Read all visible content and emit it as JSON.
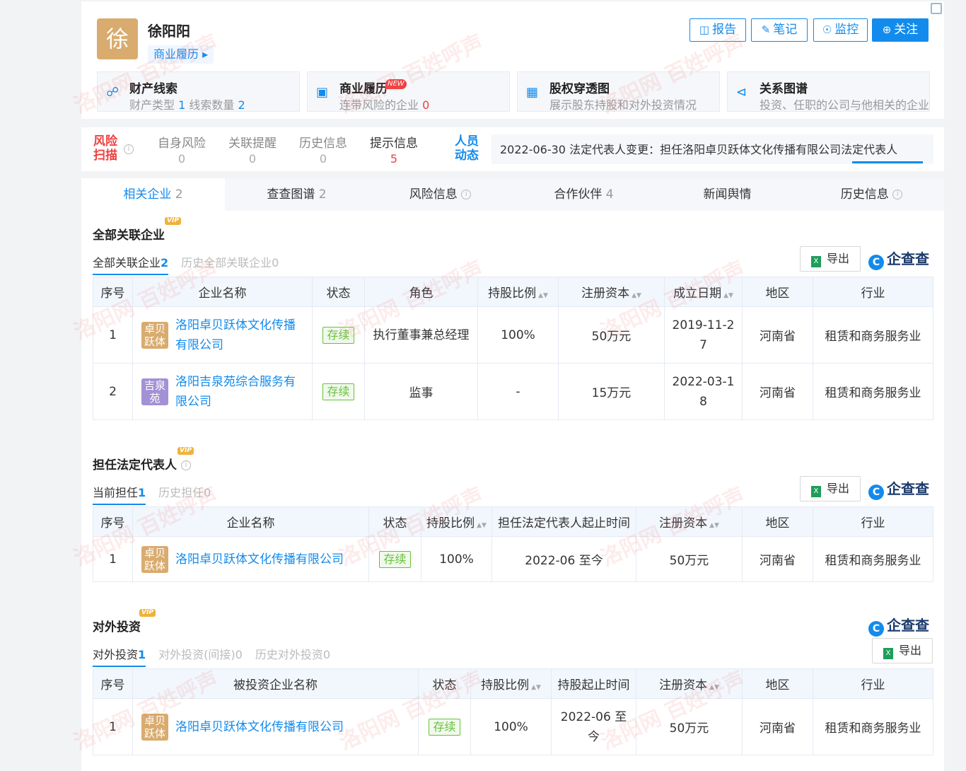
{
  "header": {
    "avatar_char": "徐",
    "name": "徐阳阳",
    "resume_link": "商业履历 ▸",
    "buttons": [
      {
        "label": "报告",
        "icon": "report-icon"
      },
      {
        "label": "笔记",
        "icon": "pen-icon"
      },
      {
        "label": "监控",
        "icon": "monitor-icon"
      },
      {
        "label": "关注",
        "icon": "plus-circle-icon"
      }
    ],
    "features": [
      {
        "title": "财产线索",
        "sub_a": "财产类型 ",
        "sub_a_num": "1",
        "sub_b": " 线索数量 ",
        "sub_b_num": "2",
        "icon": "link-icon"
      },
      {
        "title": "商业履历",
        "new_tag": "NEW",
        "sub_a": "连带风险的企业 ",
        "sub_a_num": "0",
        "icon": "briefcase-icon"
      },
      {
        "title": "股权穿透图",
        "sub_a": "展示股东持股和对外投资情况",
        "icon": "tree-icon"
      },
      {
        "title": "关系图谱",
        "sub_a": "投资、任职的公司与他相关的企业",
        "icon": "share-icon"
      }
    ]
  },
  "risk": {
    "label": "风险扫描",
    "items": [
      {
        "label": "自身风险",
        "count": "0"
      },
      {
        "label": "关联提醒",
        "count": "0"
      },
      {
        "label": "历史信息",
        "count": "0"
      },
      {
        "label": "提示信息",
        "count": "5"
      }
    ],
    "dynamic_label": "人员动态",
    "dynamic_text": "2022-06-30 法定代表人变更：担任洛阳卓贝跃体文化传播有限公司法定代表人"
  },
  "tabs": [
    {
      "label": "相关企业",
      "count": "2"
    },
    {
      "label": "查查图谱",
      "count": "2"
    },
    {
      "label": "风险信息",
      "count": ""
    },
    {
      "label": "合作伙伴",
      "count": "4"
    },
    {
      "label": "新闻舆情",
      "count": ""
    },
    {
      "label": "历史信息",
      "count": ""
    }
  ],
  "vip_tag": "VIP",
  "export_label": "导出",
  "qcc_logo": "企查查",
  "sec1": {
    "title": "全部关联企业",
    "subtabs": [
      {
        "label": "全部关联企业",
        "count": "2"
      },
      {
        "label": "历史全部关联企业",
        "count": "0"
      }
    ],
    "headers": [
      "序号",
      "企业名称",
      "状态",
      "角色",
      "持股比例",
      "注册资本",
      "成立日期",
      "地区",
      "行业"
    ],
    "rows": [
      {
        "no": "1",
        "logo": "卓贝跃体",
        "name": "洛阳卓贝跃体文化传播有限公司",
        "status": "存续",
        "role": "执行董事兼总经理",
        "ratio": "100%",
        "capital": "50万元",
        "date": "2019-11-27",
        "region": "河南省",
        "industry": "租赁和商务服务业"
      },
      {
        "no": "2",
        "logo": "吉泉苑",
        "name": "洛阳吉泉苑综合服务有限公司",
        "status": "存续",
        "role": "监事",
        "ratio": "-",
        "capital": "15万元",
        "date": "2022-03-18",
        "region": "河南省",
        "industry": "租赁和商务服务业"
      }
    ]
  },
  "sec2": {
    "title": "担任法定代表人",
    "subtabs": [
      {
        "label": "当前担任",
        "count": "1"
      },
      {
        "label": "历史担任",
        "count": "0"
      }
    ],
    "headers": [
      "序号",
      "企业名称",
      "状态",
      "持股比例",
      "担任法定代表人起止时间",
      "注册资本",
      "地区",
      "行业"
    ],
    "rows": [
      {
        "no": "1",
        "logo": "卓贝跃体",
        "name": "洛阳卓贝跃体文化传播有限公司",
        "status": "存续",
        "ratio": "100%",
        "period": "2022-06 至今",
        "capital": "50万元",
        "region": "河南省",
        "industry": "租赁和商务服务业"
      }
    ]
  },
  "sec3": {
    "title": "对外投资",
    "subtabs": [
      {
        "label": "对外投资",
        "count": "1"
      },
      {
        "label": "对外投资(间接)",
        "count": "0"
      },
      {
        "label": "历史对外投资",
        "count": "0"
      }
    ],
    "headers": [
      "序号",
      "被投资企业名称",
      "状态",
      "持股比例",
      "持股起止时间",
      "注册资本",
      "地区",
      "行业"
    ],
    "rows": [
      {
        "no": "1",
        "logo": "卓贝跃体",
        "name": "洛阳卓贝跃体文化传播有限公司",
        "status": "存续",
        "ratio": "100%",
        "period": "2022-06 至今",
        "capital": "50万元",
        "region": "河南省",
        "industry": "租赁和商务服务业"
      }
    ]
  },
  "watermark": "洛阳网 百姓呼声",
  "colors": {
    "accent": "#128bed",
    "risk_red": "#f04040",
    "status_green": "#67c23a",
    "logo_gold": "#d9ab6e",
    "logo_purple": "#a391d6"
  }
}
